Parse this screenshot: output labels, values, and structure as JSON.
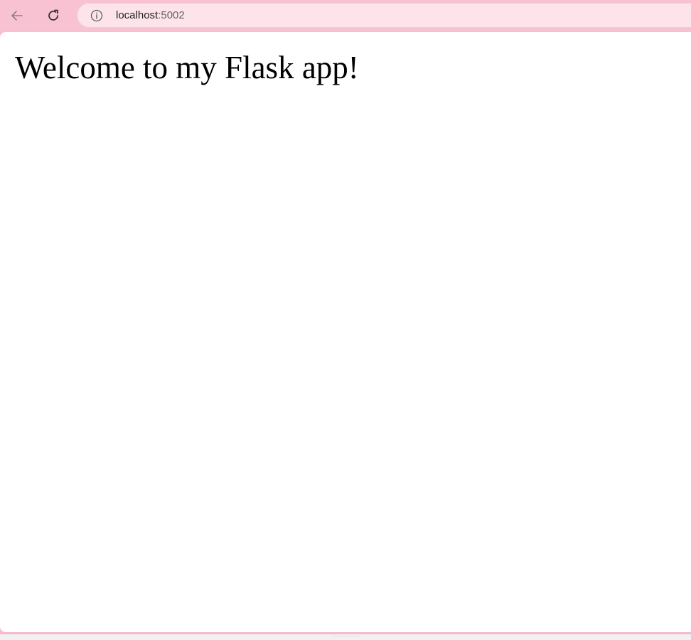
{
  "browser": {
    "toolbar": {
      "back_icon": "arrow-left-icon",
      "reload_icon": "reload-icon",
      "site_info_icon": "info-icon"
    },
    "address_bar": {
      "host": "localhost",
      "port": ":5002"
    }
  },
  "page": {
    "heading": "Welcome to my Flask app!"
  },
  "colors": {
    "toolbar_bg": "#f9c2d3",
    "address_bar_bg": "#fde4eb",
    "page_bg": "#ffffff",
    "heading_text": "#000000"
  }
}
